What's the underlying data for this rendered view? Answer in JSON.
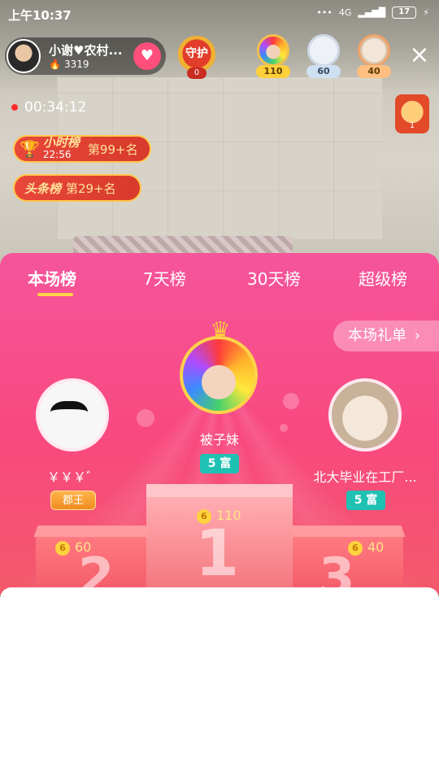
{
  "status_bar": {
    "time": "上午10:37",
    "signal": "4G",
    "battery": "17"
  },
  "host": {
    "name": "小谢♥农村...",
    "fans": "3319"
  },
  "guard": {
    "label": "守护",
    "count": "0"
  },
  "viewers": [
    {
      "score": "110"
    },
    {
      "score": "60"
    },
    {
      "score": "40"
    }
  ],
  "live": {
    "duration": "00:34:12"
  },
  "mini_viewer": {
    "count": "1"
  },
  "hour_rank": {
    "tag": "小时榜",
    "timer": "22:56",
    "rank": "第99+名"
  },
  "headline_rank": {
    "tag": "头条榜",
    "rank": "第29+名"
  },
  "panel": {
    "tabs": [
      "本场榜",
      "7天榜",
      "30天榜",
      "超级榜"
    ],
    "gift_list_label": "本场礼单",
    "first": {
      "name": "被子妹",
      "level": "5 富",
      "score": "110",
      "place": "1"
    },
    "second": {
      "name": "￥￥￥゛",
      "title_badge": "郡王",
      "score": "60",
      "place": "2"
    },
    "third": {
      "name": "北大毕业在工厂...",
      "level": "5 富",
      "score": "40",
      "place": "3"
    }
  },
  "colors": {
    "accent_pink": "#f8497f",
    "gold": "#ffc93c",
    "teal_level": "#1fc1b3"
  }
}
